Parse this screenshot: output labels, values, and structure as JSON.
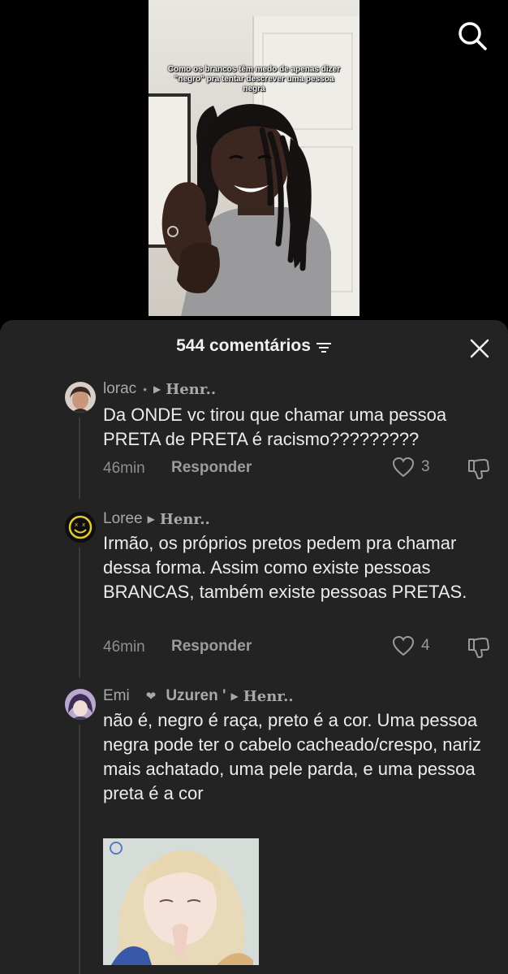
{
  "video": {
    "caption": "Como os brancos têm medo de apenas dizer \"negro\" pra tentar descrever uma pessoa negra"
  },
  "header": {
    "title": "544 comentários"
  },
  "comments": [
    {
      "author": "lorac",
      "author_suffix": "⋆",
      "reply_to": "Henr..",
      "text": "Da ONDE vc tirou que chamar uma pessoa PRETA de PRETA é racismo?????????",
      "time": "46min",
      "reply_label": "Responder",
      "likes": "3"
    },
    {
      "author": "Loree",
      "author_suffix": "",
      "reply_to": "Henr..",
      "text": "Irmão, os próprios pretos pedem pra chamar dessa forma. Assim como existe pessoas BRANCAS, também existe pessoas PRETAS.",
      "time": "46min",
      "reply_label": "Responder",
      "likes": "4"
    },
    {
      "author": "Emi",
      "author_mid": "Uzuren '",
      "reply_to": "Henr..",
      "text": "não é, negro é raça, preto é a cor. Uma pessoa negra pode ter o cabelo cacheado/crespo, nariz mais achatado, uma pele parda, e uma pessoa preta é a cor"
    }
  ],
  "colors": {
    "sheet_bg": "#232323",
    "text": "#ececec",
    "muted": "#8f8f8f"
  }
}
